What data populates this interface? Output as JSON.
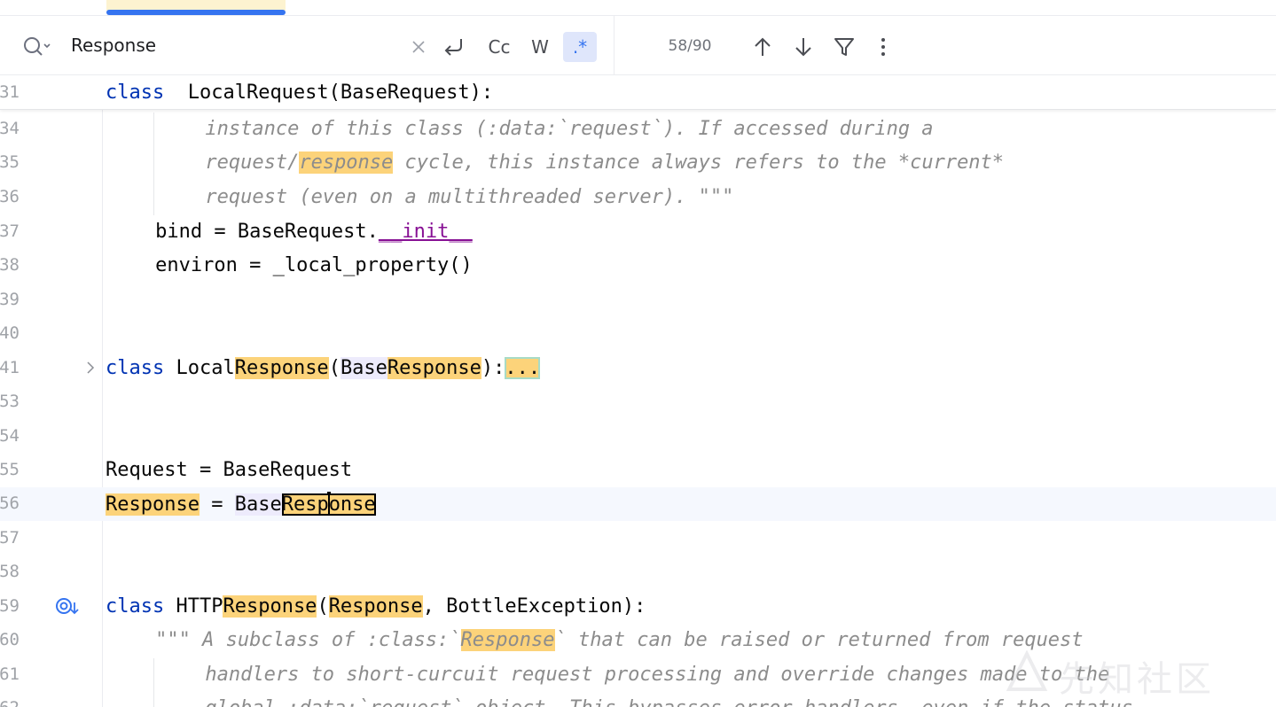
{
  "search": {
    "query": "Response",
    "match_count": "58/90",
    "toggle_case_label": "Cc",
    "toggle_words_label": "W",
    "toggle_regex_label": ".*"
  },
  "icons": {
    "search": "search-icon",
    "clear": "close-icon",
    "newline": "newline-icon",
    "prev": "arrow-up-icon",
    "next": "arrow-down-icon",
    "filter": "filter-icon",
    "more": "more-vertical-icon",
    "fold": "chevron-right-icon",
    "implemented": "implemented-override-icon"
  },
  "colors": {
    "keyword": "#0033b3",
    "magic": "#871094",
    "docstring": "#8c8c8c",
    "match_highlight": "#fcd37a",
    "accent": "#3574f0"
  },
  "lines": [
    {
      "num": "31",
      "segments": [
        [
          "kw",
          "class"
        ],
        [
          "",
          "  LocalRequest(BaseRequest):"
        ]
      ]
    },
    {
      "num": "34",
      "segments": [
        [
          "doc",
          "instance of this class (:data:`request`). If accessed during a"
        ]
      ]
    },
    {
      "num": "35",
      "segments": [
        [
          "doc",
          "request/"
        ],
        [
          "doc hl",
          "response"
        ],
        [
          "doc",
          " cycle, this instance always refers to the *current*"
        ]
      ]
    },
    {
      "num": "36",
      "segments": [
        [
          "doc",
          "request (even on a multithreaded server). \"\"\""
        ]
      ]
    },
    {
      "num": "37",
      "segments": [
        [
          "",
          "bind = BaseRequest."
        ],
        [
          "mg",
          "__init__"
        ]
      ]
    },
    {
      "num": "38",
      "segments": [
        [
          "",
          "environ = _local_property()"
        ]
      ]
    },
    {
      "num": "39",
      "segments": []
    },
    {
      "num": "40",
      "segments": []
    },
    {
      "num": "41",
      "segments": [
        [
          "kw",
          "class"
        ],
        [
          "",
          " Local"
        ],
        [
          "hl",
          "Response"
        ],
        [
          "",
          "("
        ],
        [
          "refbg",
          "Base"
        ],
        [
          "hl",
          "Response"
        ],
        [
          "",
          "):"
        ],
        [
          "fold-ph",
          "..."
        ]
      ]
    },
    {
      "num": "53",
      "segments": []
    },
    {
      "num": "54",
      "segments": []
    },
    {
      "num": "55",
      "segments": [
        [
          "",
          "Request = BaseRequest"
        ]
      ]
    },
    {
      "num": "56",
      "segments": [
        [
          "hl",
          "Response"
        ],
        [
          "",
          " = "
        ],
        [
          "refbg",
          "Base"
        ],
        [
          "hl-cur",
          "Response"
        ]
      ]
    },
    {
      "num": "57",
      "segments": []
    },
    {
      "num": "58",
      "segments": []
    },
    {
      "num": "59",
      "segments": [
        [
          "kw",
          "class"
        ],
        [
          "",
          " HTTP"
        ],
        [
          "hl",
          "Response"
        ],
        [
          "",
          "("
        ],
        [
          "hl",
          "Response"
        ],
        [
          "",
          ", BottleException):"
        ]
      ]
    },
    {
      "num": "60",
      "segments": [
        [
          "doc",
          "\"\"\" A subclass of :class:`"
        ],
        [
          "doc hl",
          "Response"
        ],
        [
          "doc",
          "` that can be raised or returned from request"
        ]
      ]
    },
    {
      "num": "61",
      "segments": [
        [
          "doc",
          "handlers to short-curcuit request processing and override changes made to the"
        ]
      ]
    },
    {
      "num": "62",
      "segments": [
        [
          "doc",
          "global :data:`request` object. This bypasses error handlers, even if the status"
        ]
      ]
    }
  ],
  "watermark": "先知社区"
}
